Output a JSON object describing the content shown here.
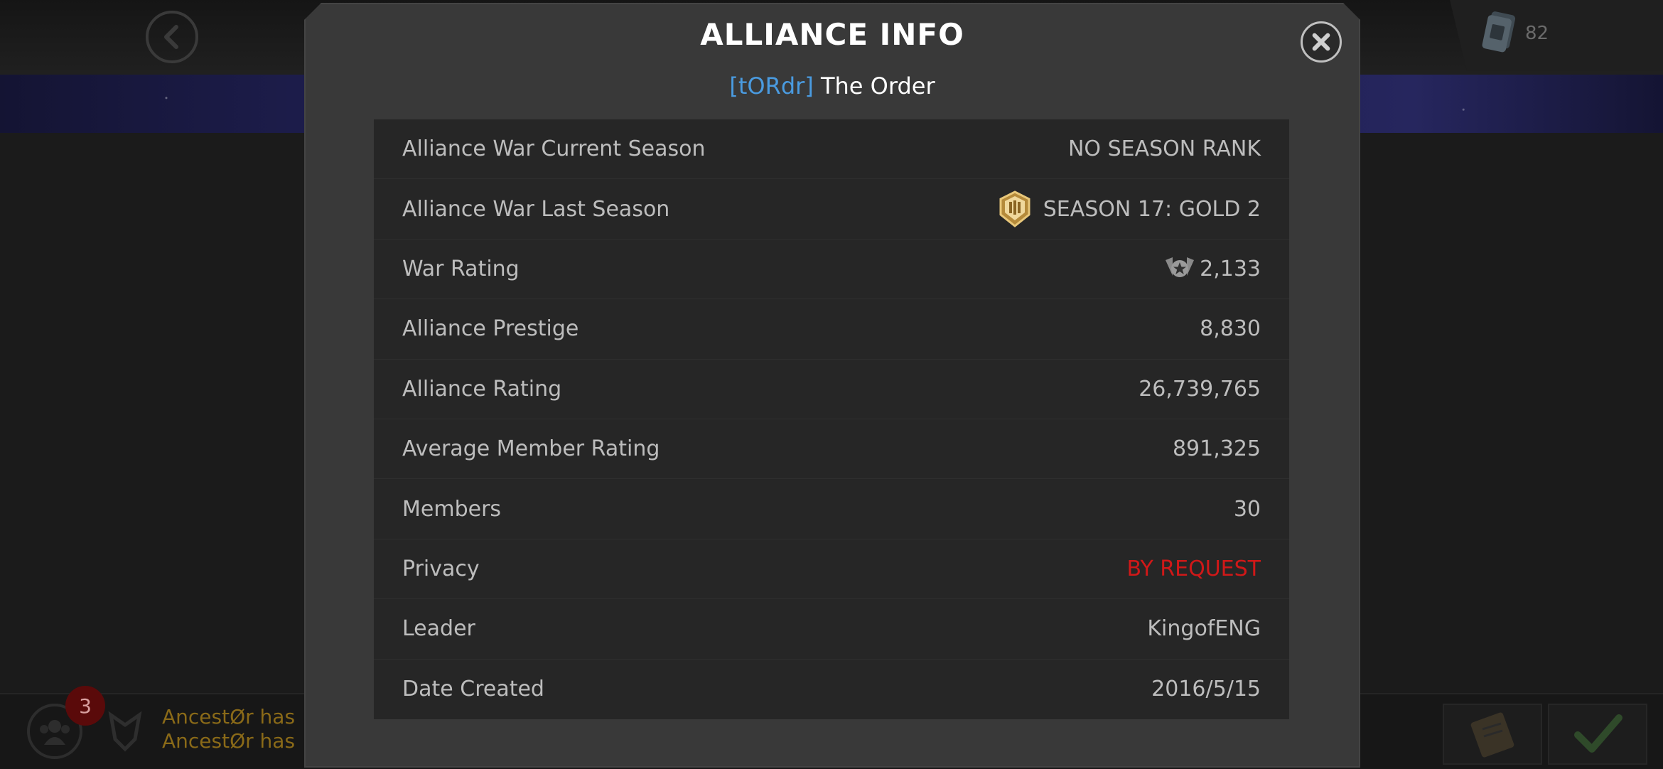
{
  "background": {
    "currency_count": "82",
    "notification_count": "3",
    "chat_lines": [
      "AncestØr has",
      "AncestØr has"
    ]
  },
  "modal": {
    "title": "ALLIANCE INFO",
    "tag": "[tORdr]",
    "name": "The Order",
    "rows": [
      {
        "label": "Alliance War Current Season",
        "value": "NO SEASON RANK"
      },
      {
        "label": "Alliance War Last Season",
        "value": "SEASON 17: GOLD 2",
        "icon": "gold-season-badge-icon"
      },
      {
        "label": "War Rating",
        "value": "2,133",
        "icon": "war-rating-icon"
      },
      {
        "label": "Alliance Prestige",
        "value": "8,830"
      },
      {
        "label": "Alliance Rating",
        "value": "26,739,765"
      },
      {
        "label": "Average Member Rating",
        "value": "891,325"
      },
      {
        "label": "Members",
        "value": "30"
      },
      {
        "label": "Privacy",
        "value": "BY REQUEST",
        "color": "#d01818"
      },
      {
        "label": "Leader",
        "value": "KingofENG"
      },
      {
        "label": "Date Created",
        "value": "2016/5/15"
      }
    ]
  },
  "colors": {
    "tag": "#4a9be0",
    "privacy": "#d01818",
    "modal_bg": "#393939",
    "table_bg": "#262626"
  }
}
